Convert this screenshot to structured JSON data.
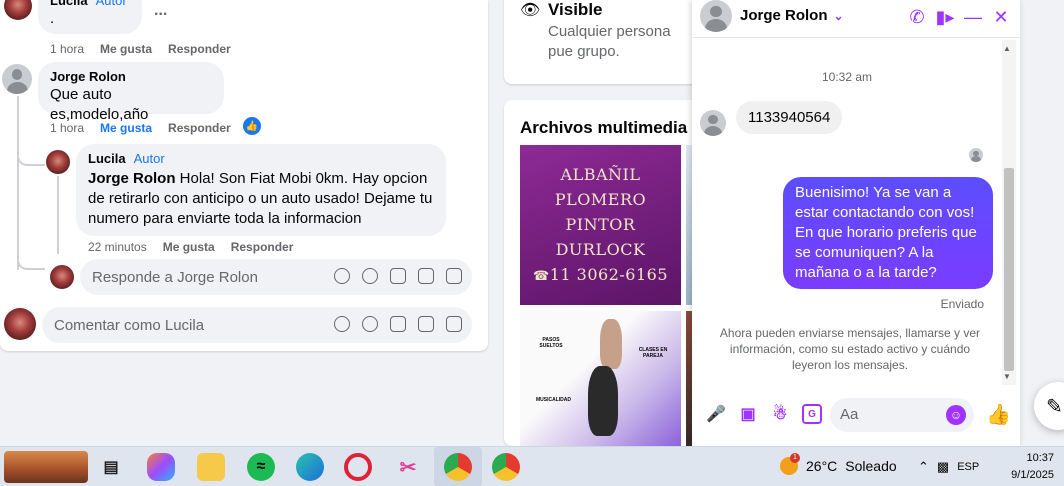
{
  "feed": {
    "top_comment": {
      "author": "Lucila",
      "author_badge": "Autor",
      "text": ".",
      "more": "...",
      "time": "1 hora",
      "like": "Me gusta",
      "reply": "Responder"
    },
    "comment": {
      "author": "Jorge Rolon",
      "text": "Que auto es,modelo,año",
      "time": "1 hora",
      "like": "Me gusta",
      "reply": "Responder",
      "like_icon": "thumbs-up-icon"
    },
    "reply": {
      "author": "Lucila",
      "author_badge": "Autor",
      "mention": "Jorge Rolon",
      "text": " Hola! Son Fiat Mobi 0km. Hay opcion de retirarlo con anticipo o un auto usado! Dejame tu numero para enviarte toda la informacion",
      "time": "22 minutos",
      "like": "Me gusta",
      "reply": "Responder"
    },
    "reply_input_placeholder": "Responde a Jorge Rolon",
    "comment_input_placeholder": "Comentar como Lucila"
  },
  "side": {
    "visible_title": "Visible",
    "visible_desc": "Cualquier persona pue grupo.",
    "media_title": "Archivos multimedia re",
    "tile1_lines": [
      "ALBAÑIL",
      "PLOMERO",
      "PINTOR",
      "DURLOCK",
      "11 3062-6165"
    ],
    "tile2_texts": [
      "PASOS SUELTOS",
      "CLASES EN PAREJA",
      "MUSICALIDAD"
    ]
  },
  "chat": {
    "contact": "Jorge Rolon",
    "time": "10:32 am",
    "incoming": "1133940564",
    "outgoing": "Buenisimo! Ya se van a estar contactando con vos! En que horario preferis que se comuniquen? A la mañana o a la tarde?",
    "status": "Enviado",
    "info": "Ahora pueden enviarse mensajes, llamarse y ver información, como su estado activo y cuándo leyeron los mensajes.",
    "input_placeholder": "Aa",
    "accent": "#a033ff"
  },
  "taskbar": {
    "weather_temp": "26°C",
    "weather_desc": "Soleado",
    "weather_badge": "1",
    "lang": "ESP",
    "time": "10:37",
    "date": "9/1/2025"
  }
}
